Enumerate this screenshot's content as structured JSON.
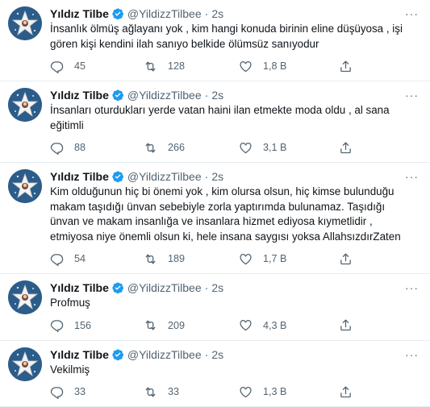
{
  "tweets": [
    {
      "name": "Yıldız Tilbe",
      "handle": "@YildizzTilbee",
      "dot": "·",
      "time": "2s",
      "text": "İnsanlık ölmüş ağlayanı yok , kim hangi konuda birinin eline düşüyosa , işi gören kişi kendini ilah sanıyo belkide ölümsüz sanıyodur",
      "replies": "45",
      "retweets": "128",
      "likes": "1,8 B"
    },
    {
      "name": "Yıldız Tilbe",
      "handle": "@YildizzTilbee",
      "dot": "·",
      "time": "2s",
      "text": "İnsanları oturdukları yerde vatan haini ilan etmekte moda oldu , al sana eğitimli",
      "replies": "88",
      "retweets": "266",
      "likes": "3,1 B"
    },
    {
      "name": "Yıldız Tilbe",
      "handle": "@YildizzTilbee",
      "dot": "·",
      "time": "2s",
      "text": "Kim olduğunun hiç bi önemi yok , kim olursa olsun, hiç kimse bulunduğu makam taşıdığı ünvan sebebiyle zorla yaptırımda bulunamaz. Taşıdığı ünvan ve makam insanlığa ve insanlara hizmet ediyosa kıymetlidir , etmiyosa niye önemli olsun ki, hele insana saygısı yoksa AllahsızdırZaten",
      "replies": "54",
      "retweets": "189",
      "likes": "1,7 B"
    },
    {
      "name": "Yıldız Tilbe",
      "handle": "@YildizzTilbee",
      "dot": "·",
      "time": "2s",
      "text": "Profmuş",
      "replies": "156",
      "retweets": "209",
      "likes": "4,3 B"
    },
    {
      "name": "Yıldız Tilbe",
      "handle": "@YildizzTilbee",
      "dot": "·",
      "time": "2s",
      "text": "Vekilmiş",
      "replies": "33",
      "retweets": "33",
      "likes": "1,3 B"
    }
  ],
  "icons": {
    "avatar": "star-avatar-icon",
    "verified": "verified-badge-icon",
    "more": "more-options-icon",
    "reply": "reply-icon",
    "retweet": "retweet-icon",
    "like": "like-icon",
    "share": "share-icon"
  },
  "colors": {
    "verified": "#1d9bf0",
    "text": "#0f1419",
    "muted": "#536471",
    "divider": "#e6ecf0"
  }
}
